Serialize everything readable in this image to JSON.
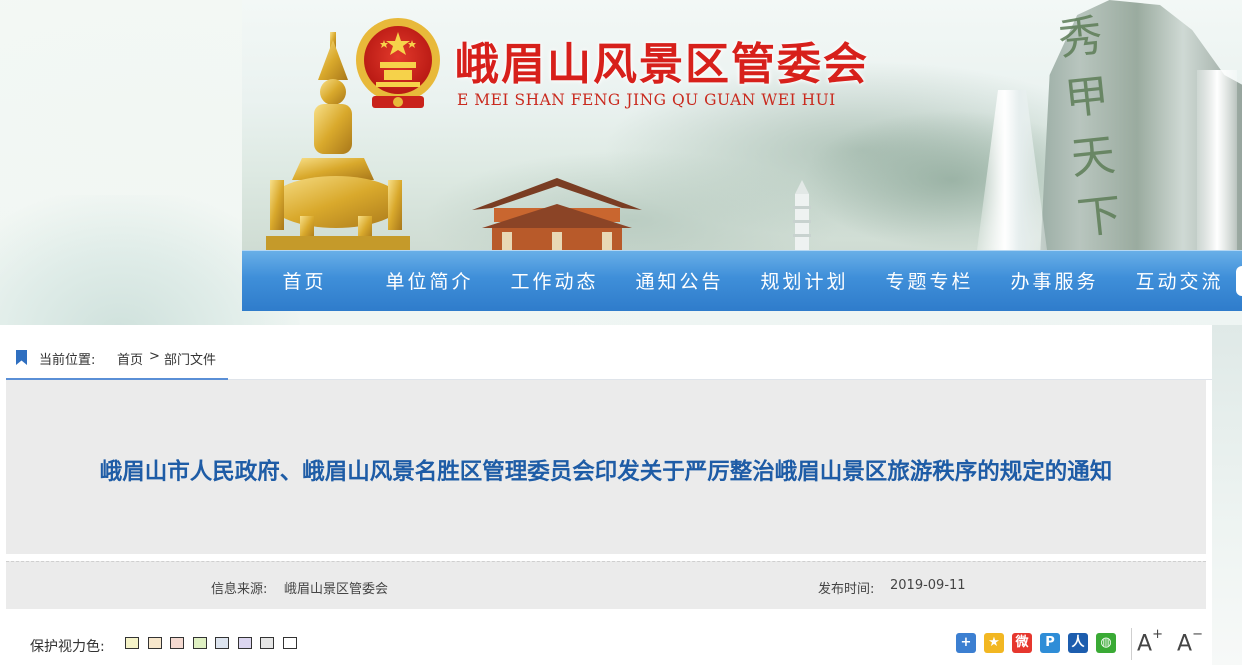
{
  "header": {
    "title": "峨眉山风景区管委会",
    "subtitle": "E MEI SHAN FENG JING QU GUAN WEI HUI",
    "cliff_inscription": "秀甲天下",
    "title_color": "#d7201b"
  },
  "nav": {
    "items": [
      {
        "label": "首页"
      },
      {
        "label": "单位简介"
      },
      {
        "label": "工作动态"
      },
      {
        "label": "通知公告"
      },
      {
        "label": "规划计划"
      },
      {
        "label": "专题专栏"
      },
      {
        "label": "办事服务"
      },
      {
        "label": "互动交流"
      }
    ],
    "bg_color": "#3f8fd9"
  },
  "breadcrumb": {
    "prefix": "当前位置:",
    "home": "首页",
    "separator": ">",
    "current": "部门文件"
  },
  "article": {
    "title": "峨眉山市人民政府、峨眉山风景名胜区管理委员会印发关于严厉整治峨眉山景区旅游秩序的规定的通知",
    "source_label": "信息来源:",
    "source": "峨眉山景区管委会",
    "date_label": "发布时间:",
    "date": "2019-09-11",
    "title_color": "#1e5ca6"
  },
  "eye_protection": {
    "label": "保护视力色:",
    "colors": [
      "#f5f3c8",
      "#f7e7cc",
      "#f4d9d0",
      "#dff0c2",
      "#dde4ef",
      "#dcd6f0",
      "#e5e5e5",
      "#ffffff"
    ]
  },
  "share": {
    "icons": [
      {
        "name": "share-more-icon",
        "color": "#3c7fd1",
        "glyph": "+"
      },
      {
        "name": "qzone-icon",
        "color": "#f2b722",
        "glyph": "★"
      },
      {
        "name": "weibo-icon",
        "color": "#e6372e",
        "glyph": "微"
      },
      {
        "name": "tencent-weibo-icon",
        "color": "#2f8dd7",
        "glyph": "P"
      },
      {
        "name": "renren-icon",
        "color": "#1c5dae",
        "glyph": "人"
      },
      {
        "name": "wechat-icon",
        "color": "#3aaa35",
        "glyph": "◍"
      }
    ],
    "font_increase": "A",
    "font_increase_sign": "+",
    "font_decrease": "A",
    "font_decrease_sign": "−"
  }
}
